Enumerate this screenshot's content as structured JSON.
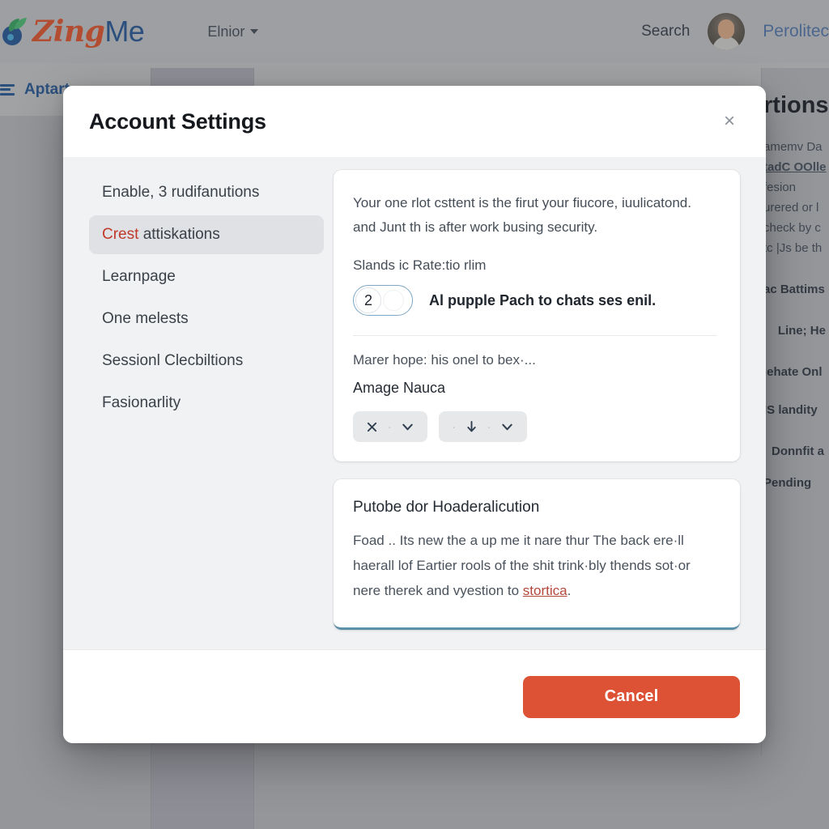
{
  "topbar": {
    "brand_first": "Zing",
    "brand_second": "Me",
    "nav_dropdown": "Elnior",
    "search_label": "Search",
    "user_name": "Perolitec",
    "brand_color_first": "#dd4b20",
    "brand_color_second": "#1d4f8f"
  },
  "subbar": {
    "label": "Aptart"
  },
  "background_panel": {
    "title": "rtions T",
    "lines": [
      "amemv Da",
      "tadC OOlle",
      "fesion",
      "urered or l",
      "check by c",
      "tc |Js be  th",
      "аc Battims",
      "Line; He",
      "iehate Onl",
      "IS landity",
      "Donnfit a",
      "Pending"
    ]
  },
  "modal": {
    "title": "Account Settings",
    "close_icon_label": "×",
    "nav_items": [
      {
        "lead": "",
        "label": "Enable, 3 rudifanutions",
        "active": false
      },
      {
        "lead": "Crest ",
        "label": "attiskations",
        "active": true
      },
      {
        "lead": "",
        "label": "Learnpage",
        "active": false
      },
      {
        "lead": "",
        "label": "One melests",
        "active": false
      },
      {
        "lead": "",
        "label": "Sessionl Clecbiltions",
        "active": false
      },
      {
        "lead": "",
        "label": "Fasionarlity",
        "active": false
      }
    ],
    "card_primary": {
      "paragraph": "Your one rlot csttent is the firut your fiucore, iuulicatond. and Junt th is after work busing security.",
      "sub_label": "Slands ic Rate:tio rlim",
      "toggle_value": "2",
      "toggle_text": "Al pupple Pach to chats ses enil.",
      "hint": "Marer hope: his onel to bex·...",
      "field_name": "Amage Nauca",
      "button_group_1": {
        "icon_a": "close-icon",
        "icon_b": "chevron-down-icon"
      },
      "button_group_2": {
        "icon_a": "arrow-down-icon",
        "icon_b": "chevron-down-icon"
      }
    },
    "card_secondary": {
      "heading": "Putobe dor Hoaderalicution",
      "body_before_link": "Foad .. Its new the a up me it nare thur The back ere·ll haerall lof Eartier rools of the shit trink·bly thends sot·or nere therek and vyestion to ",
      "link_text": "stortica",
      "body_after_link": ".",
      "accent_color": "#5c8fa8",
      "link_color": "#b4483a"
    },
    "footer": {
      "cancel_label": "Cancel",
      "cancel_color": "#dd5134"
    }
  }
}
